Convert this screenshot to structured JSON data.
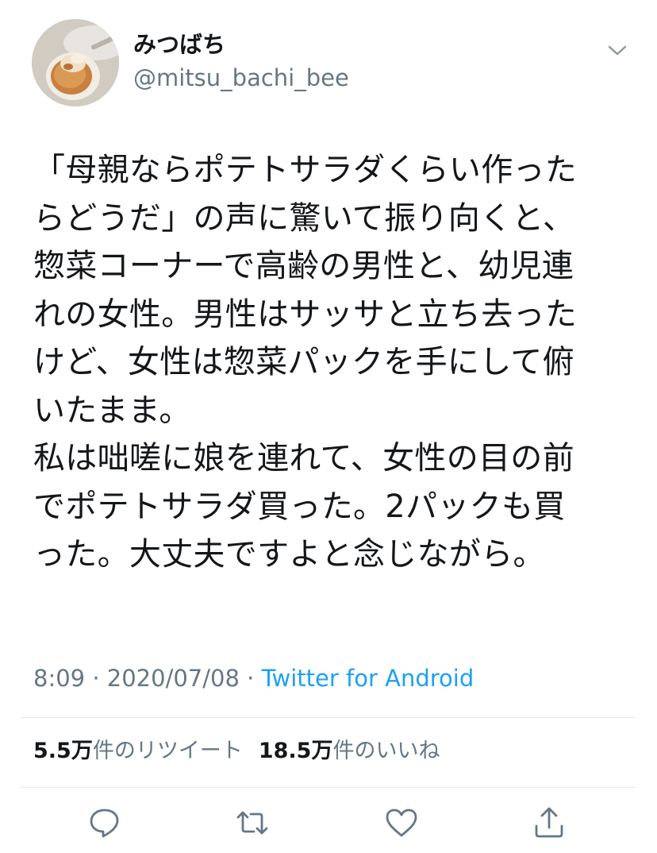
{
  "user": {
    "display_name": "みつばち",
    "handle": "@mitsu_bachi_bee",
    "avatar": "avatar-photo-dessert",
    "menu_icon": "chevron-down-icon"
  },
  "tweet": {
    "lines": [
      "「母親ならポテトサラダくらい作った",
      "らどうだ」の声に驚いて振り向くと、",
      "惣菜コーナーで高齢の男性と、幼児連",
      "れの女性。男性はサッサと立ち去った",
      "けど、女性は惣菜パックを手にして俯",
      "いたまま。",
      "私は咄嗟に娘を連れて、女性の目の前",
      "でポテトサラダ買った。2パックも買",
      "った。大丈夫ですよと念じながら。"
    ]
  },
  "meta": {
    "time": "8:09",
    "separator": "·",
    "date": "2020/07/08",
    "source": "Twitter for Android"
  },
  "stats": {
    "retweet_count": "5.5万",
    "retweet_label": "件のリツイート",
    "like_count": "18.5万",
    "like_label": "件のいいね"
  },
  "actions": {
    "reply": "reply-icon",
    "retweet": "retweet-icon",
    "like": "heart-icon",
    "share": "share-icon"
  },
  "colors": {
    "text": "#14171a",
    "secondary": "#657786",
    "link": "#1da1f2",
    "divider": "#e1e8ed"
  }
}
